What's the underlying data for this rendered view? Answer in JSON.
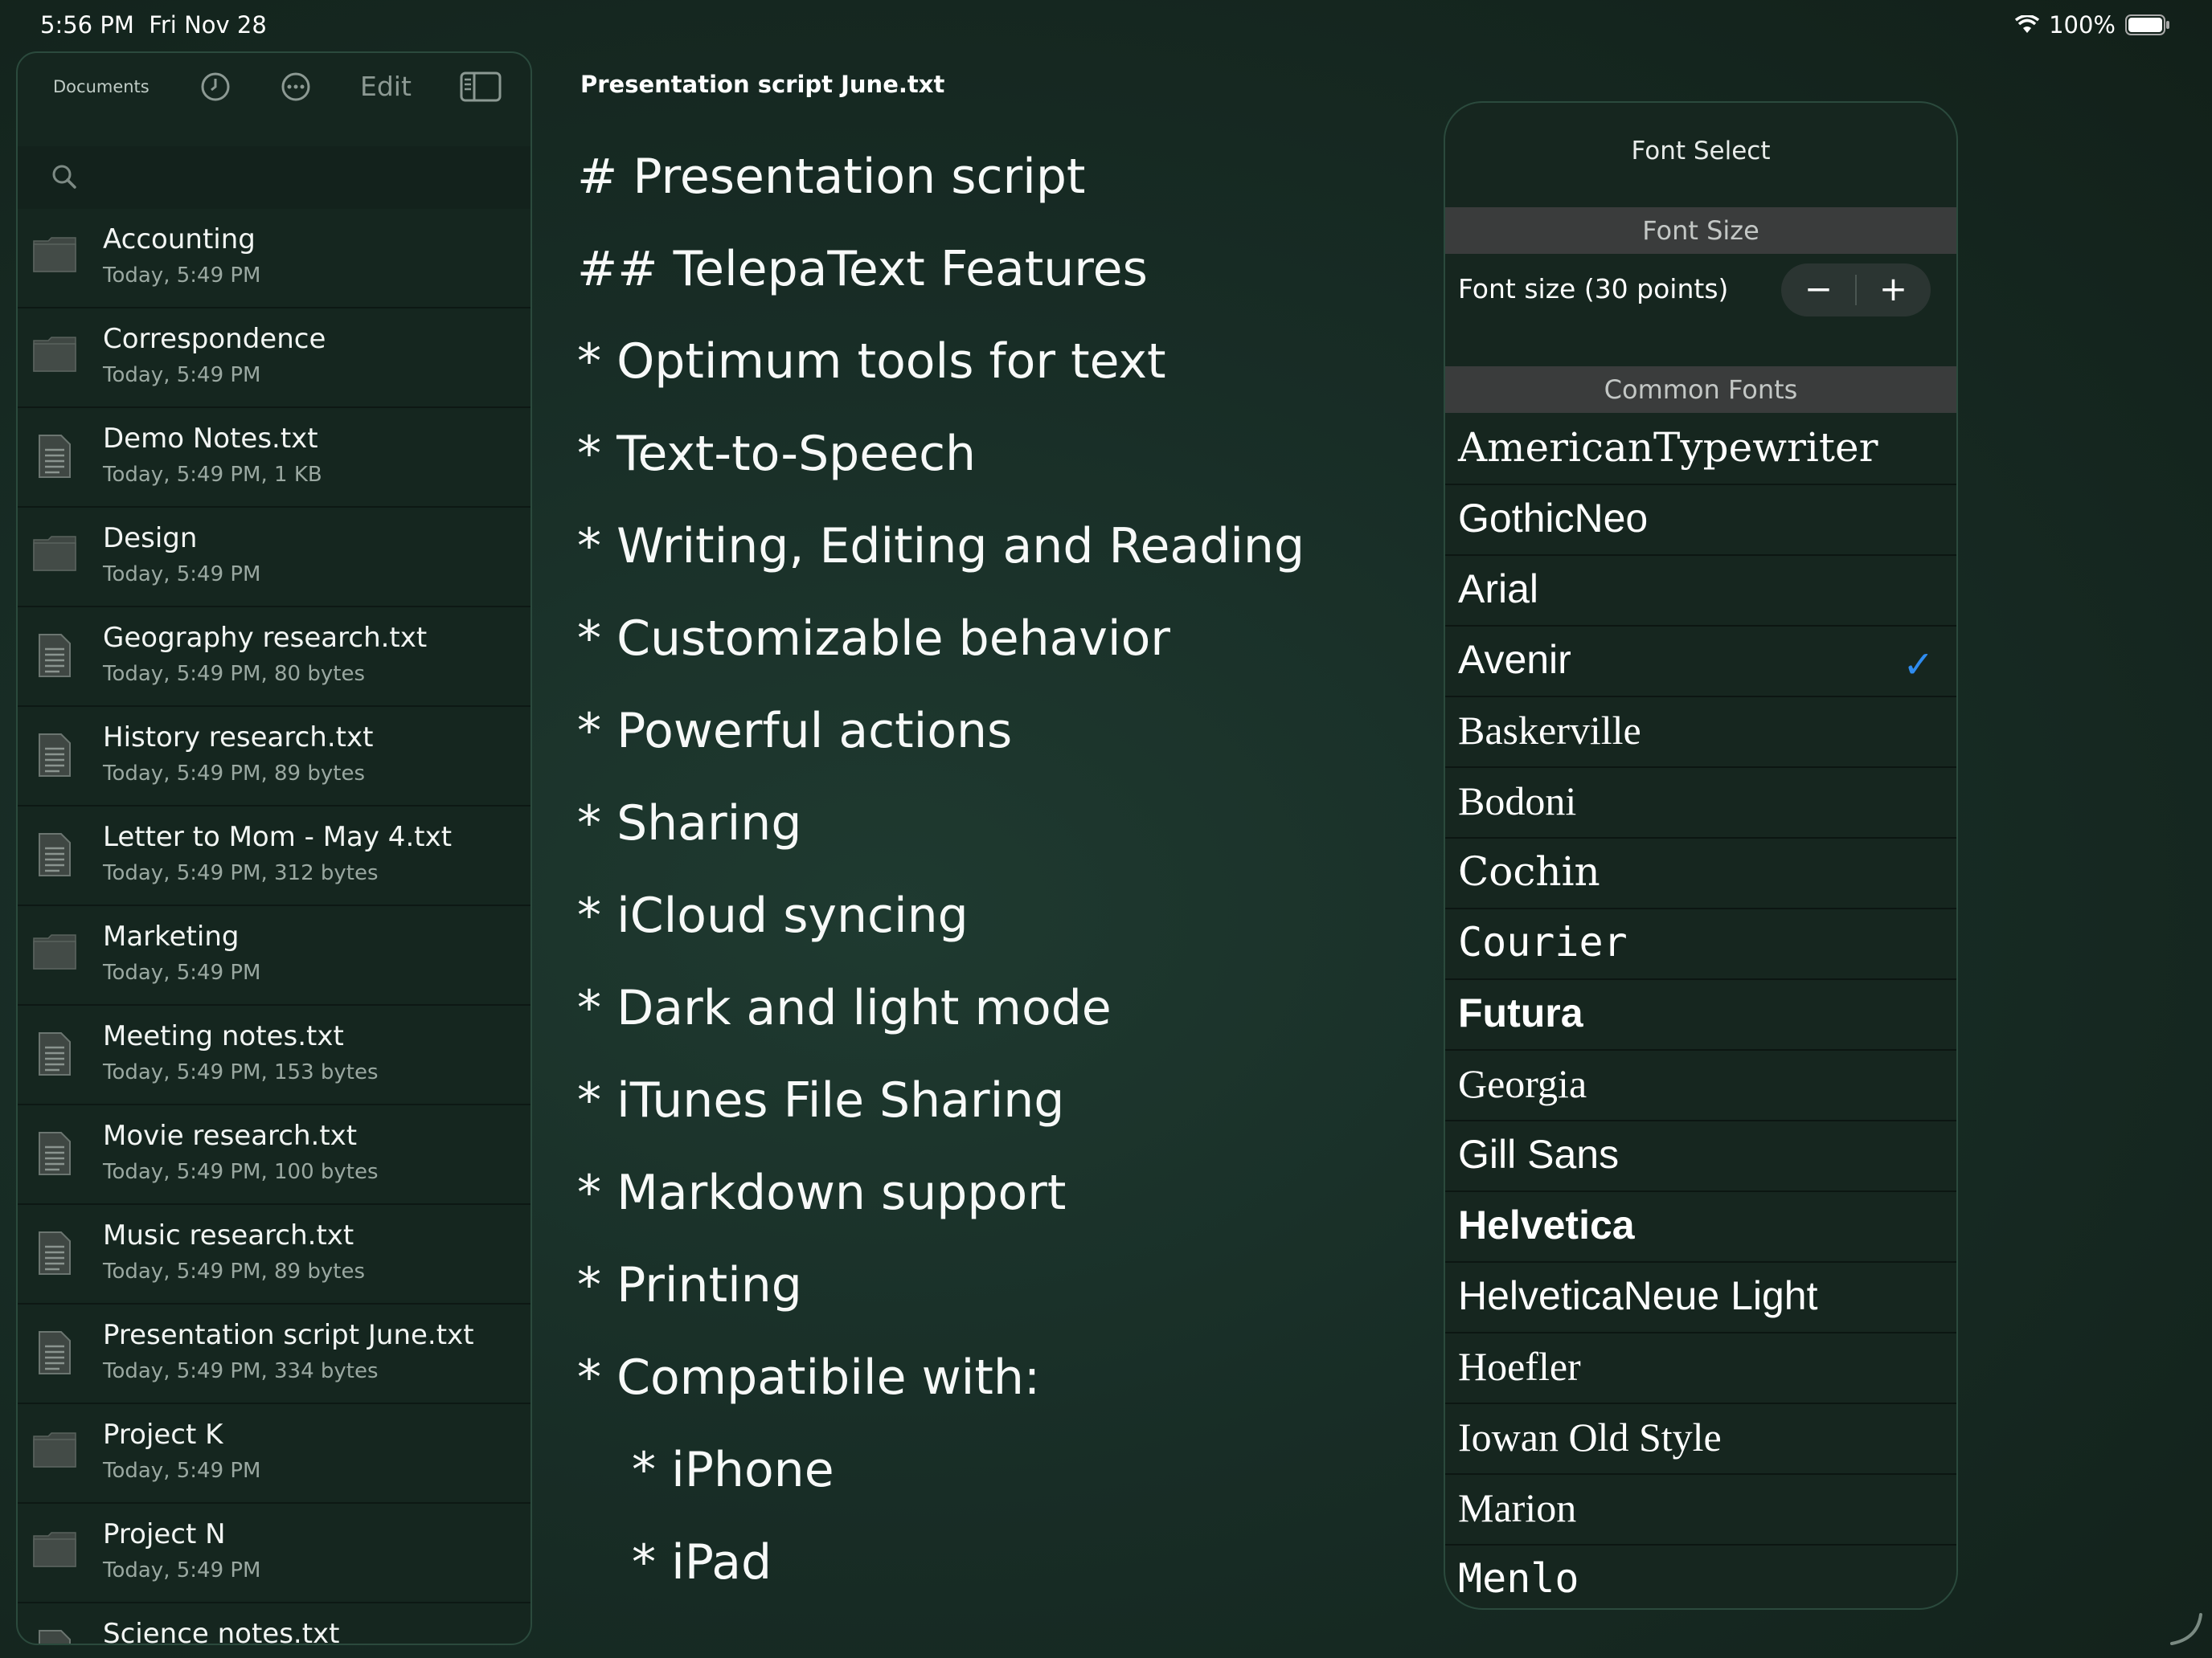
{
  "status_bar": {
    "time": "5:56 PM",
    "date": "Fri Nov 28",
    "battery": "100%"
  },
  "sidebar": {
    "title": "Documents",
    "edit_label": "Edit",
    "items": [
      {
        "name": "Accounting",
        "meta": "Today, 5:49 PM",
        "type": "folder"
      },
      {
        "name": "Correspondence",
        "meta": "Today, 5:49 PM",
        "type": "folder"
      },
      {
        "name": "Demo Notes.txt",
        "meta": "Today, 5:49 PM, 1 KB",
        "type": "file"
      },
      {
        "name": "Design",
        "meta": "Today, 5:49 PM",
        "type": "folder"
      },
      {
        "name": "Geography research.txt",
        "meta": "Today, 5:49 PM, 80 bytes",
        "type": "file"
      },
      {
        "name": "History research.txt",
        "meta": "Today, 5:49 PM, 89 bytes",
        "type": "file"
      },
      {
        "name": "Letter to Mom - May 4.txt",
        "meta": "Today, 5:49 PM, 312 bytes",
        "type": "file"
      },
      {
        "name": "Marketing",
        "meta": "Today, 5:49 PM",
        "type": "folder"
      },
      {
        "name": "Meeting notes.txt",
        "meta": "Today, 5:49 PM, 153 bytes",
        "type": "file"
      },
      {
        "name": "Movie research.txt",
        "meta": "Today, 5:49 PM, 100 bytes",
        "type": "file"
      },
      {
        "name": "Music research.txt",
        "meta": "Today, 5:49 PM, 89 bytes",
        "type": "file"
      },
      {
        "name": "Presentation script June.txt",
        "meta": "Today, 5:49 PM, 334 bytes",
        "type": "file"
      },
      {
        "name": "Project K",
        "meta": "Today, 5:49 PM",
        "type": "folder"
      },
      {
        "name": "Project N",
        "meta": "Today, 5:49 PM",
        "type": "folder"
      },
      {
        "name": "Science notes.txt",
        "meta": "",
        "type": "file"
      }
    ]
  },
  "editor": {
    "doc_title": "Presentation script June.txt",
    "lines": [
      "# Presentation script",
      "## TelepaText Features",
      "* Optimum tools for text",
      "* Text-to-Speech",
      "* Writing, Editing and Reading",
      "* Customizable behavior",
      "* Powerful actions",
      "* Sharing",
      "* iCloud syncing",
      "* Dark and light mode",
      "* iTunes File Sharing",
      "* Markdown support",
      "* Printing",
      "* Compatibile with:",
      "* iPhone",
      "* iPad"
    ]
  },
  "font_panel": {
    "title": "Font Select",
    "size_header": "Font Size",
    "size_label": "Font size (30 points)",
    "minus": "−",
    "plus": "+",
    "fonts_header": "Common Fonts",
    "fonts": [
      "AmericanTypewriter",
      "GothicNeo",
      "Arial",
      "Avenir",
      "Baskerville",
      "Bodoni",
      "Cochin",
      "Courier",
      "Futura",
      "Georgia",
      "Gill Sans",
      "Helvetica",
      "HelveticaNeue Light",
      "Hoefler",
      "Iowan Old Style",
      "Marion",
      "Menlo"
    ],
    "selected_font": "Avenir",
    "check_mark": "✓",
    "accent_color": "#2f8cf0"
  }
}
